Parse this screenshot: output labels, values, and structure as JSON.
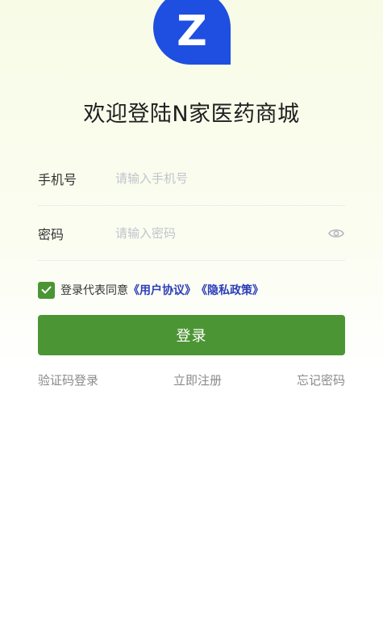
{
  "logo": {
    "letter": "Z",
    "color": "#1f4fe0"
  },
  "title": "欢迎登陆N家医药商城",
  "phone": {
    "label": "手机号",
    "placeholder": "请输入手机号",
    "value": ""
  },
  "password": {
    "label": "密码",
    "placeholder": "请输入密码",
    "value": "",
    "toggle_icon": "eye-icon"
  },
  "agreement": {
    "checked": true,
    "text": "登录代表同意",
    "user_agreement": "《用户协议》",
    "privacy_policy": "《隐私政策》",
    "link_color": "#2c3db8"
  },
  "login_button": {
    "label": "登录",
    "color": "#4c9535"
  },
  "links": {
    "sms_login": "验证码登录",
    "register": "立即注册",
    "forgot_password": "忘记密码"
  }
}
